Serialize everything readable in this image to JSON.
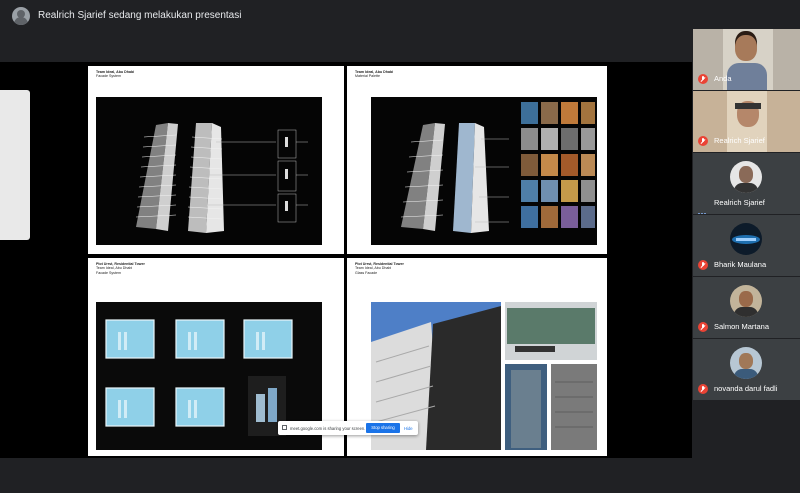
{
  "presenter": {
    "text": "Realrich Sjarief sedang melakukan presentasi"
  },
  "slides": [
    {
      "meta1": "Team Ideal, Abu Dhabi",
      "meta2": "Facade System"
    },
    {
      "meta1": "Team Ideal, Abu Dhabi",
      "meta2": "Material Palette"
    },
    {
      "meta1": "Plot Urrst, Residential Tower",
      "meta2": "Team Ideal, Abu Dhabi",
      "meta3": "Facade System"
    },
    {
      "meta1": "Plot Urrst, Residential Tower",
      "meta2": "Team Ideal, Abu Dhabi",
      "meta3": "Glass Facade"
    }
  ],
  "share_banner": {
    "text": "meet.google.com is sharing your screen.",
    "stop_label": "Stop sharing",
    "hide_label": "Hide"
  },
  "participants": [
    {
      "name": "Anda",
      "muted": true
    },
    {
      "name": "Realrich Sjarief",
      "muted": true
    },
    {
      "name": "Realrich Sjarief",
      "muted": false,
      "speaking": true
    },
    {
      "name": "Bharik Maulana",
      "muted": true
    },
    {
      "name": "Salmon Martana",
      "muted": true
    },
    {
      "name": "novanda darul fadli",
      "muted": true
    }
  ],
  "colors": {
    "mic_off": "#ea4335",
    "stop_button": "#1a73e8",
    "background": "#202124"
  }
}
